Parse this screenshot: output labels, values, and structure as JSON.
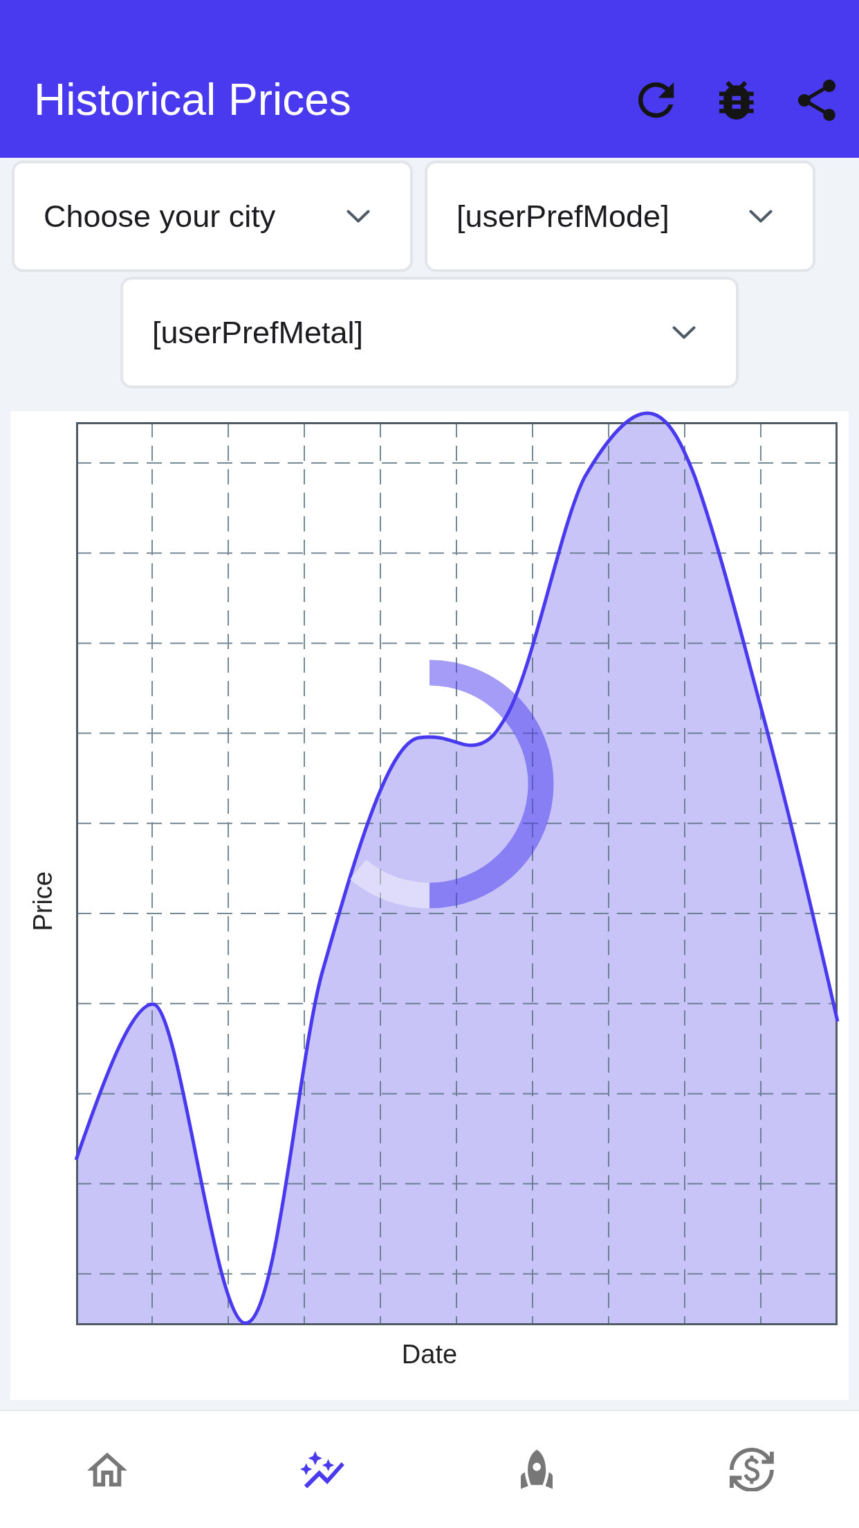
{
  "app_bar": {
    "title": "Historical Prices"
  },
  "selectors": [
    {
      "text": "Choose your city"
    },
    {
      "text": "[userPrefMode]"
    },
    {
      "text": "[userPrefMetal]"
    }
  ],
  "chart": {
    "ylabel": "Price",
    "xlabel": "Date",
    "loading": true
  },
  "bottom_nav": [
    {
      "selected": false
    },
    {
      "selected": true
    },
    {
      "selected": false
    },
    {
      "selected": false
    }
  ]
}
